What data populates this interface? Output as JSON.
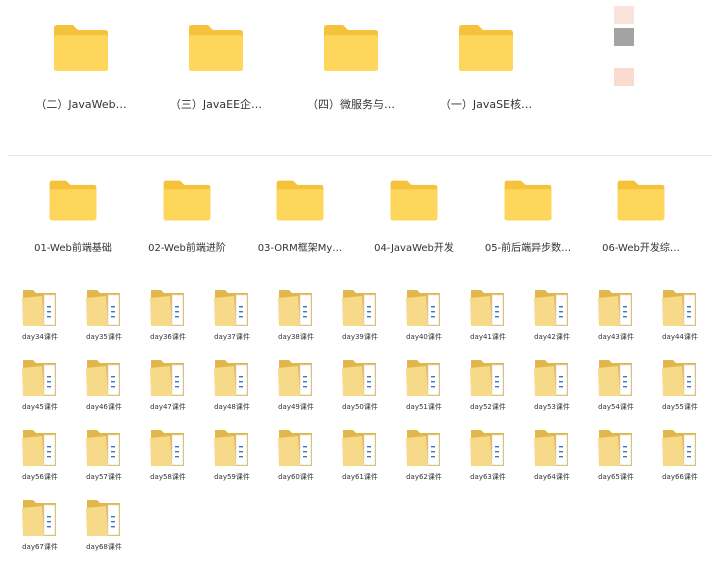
{
  "colors": {
    "folder_back": "#F5C33B",
    "folder_front": "#FFD65C",
    "open_folder_back": "#E2B64A",
    "open_folder_front": "#F7D98A",
    "paper": "#FFFFFF",
    "paper_accent": "#3A76C4",
    "label_text": "#333333",
    "swatch_top": "#F9E3DA",
    "swatch_mid": "#A3A3A3",
    "swatch_bottom": "#FADBD0"
  },
  "top_folders": [
    {
      "label": "（二）JavaWeb…",
      "icon": "folder-icon"
    },
    {
      "label": "（三）JavaEE企…",
      "icon": "folder-icon"
    },
    {
      "label": "（四）微服务与…",
      "icon": "folder-icon"
    },
    {
      "label": "（一）JavaSE核…",
      "icon": "folder-icon"
    }
  ],
  "mid_folders": [
    {
      "label": "01-Web前端基础",
      "icon": "folder-icon"
    },
    {
      "label": "02-Web前端进阶",
      "icon": "folder-icon"
    },
    {
      "label": "03-ORM框架My…",
      "icon": "folder-icon"
    },
    {
      "label": "04-JavaWeb开发",
      "icon": "folder-icon"
    },
    {
      "label": "05-前后端异步数…",
      "icon": "folder-icon"
    },
    {
      "label": "06-Web开发综…",
      "icon": "folder-icon"
    }
  ],
  "day_folders": [
    {
      "label": "day34课件"
    },
    {
      "label": "day35课件"
    },
    {
      "label": "day36课件"
    },
    {
      "label": "day37课件"
    },
    {
      "label": "day38课件"
    },
    {
      "label": "day39课件"
    },
    {
      "label": "day40课件"
    },
    {
      "label": "day41课件"
    },
    {
      "label": "day42课件"
    },
    {
      "label": "day43课件"
    },
    {
      "label": "day44课件"
    },
    {
      "label": "day45课件"
    },
    {
      "label": "day46课件"
    },
    {
      "label": "day47课件"
    },
    {
      "label": "day48课件"
    },
    {
      "label": "day49课件"
    },
    {
      "label": "day50课件"
    },
    {
      "label": "day51课件"
    },
    {
      "label": "day52课件"
    },
    {
      "label": "day53课件"
    },
    {
      "label": "day54课件"
    },
    {
      "label": "day55课件"
    },
    {
      "label": "day56课件"
    },
    {
      "label": "day57课件"
    },
    {
      "label": "day58课件"
    },
    {
      "label": "day59课件"
    },
    {
      "label": "day60课件"
    },
    {
      "label": "day61课件"
    },
    {
      "label": "day62课件"
    },
    {
      "label": "day63课件"
    },
    {
      "label": "day64课件"
    },
    {
      "label": "day65课件"
    },
    {
      "label": "day66课件"
    },
    {
      "label": "day67课件"
    },
    {
      "label": "day68课件"
    }
  ]
}
